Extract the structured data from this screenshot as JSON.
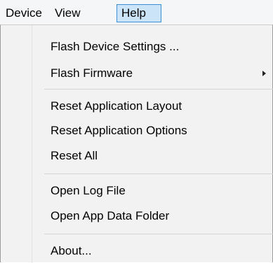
{
  "menubar": {
    "items": [
      {
        "label": "Device",
        "active": false
      },
      {
        "label": "View",
        "active": false
      },
      {
        "label": "Help",
        "active": true
      }
    ]
  },
  "help_menu": {
    "groups": [
      [
        {
          "label": "Flash Device Settings ...",
          "has_submenu": false
        },
        {
          "label": "Flash Firmware",
          "has_submenu": true
        }
      ],
      [
        {
          "label": "Reset Application Layout",
          "has_submenu": false
        },
        {
          "label": "Reset Application Options",
          "has_submenu": false
        },
        {
          "label": "Reset All",
          "has_submenu": false
        }
      ],
      [
        {
          "label": "Open Log File",
          "has_submenu": false
        },
        {
          "label": "Open App Data Folder",
          "has_submenu": false
        }
      ],
      [
        {
          "label": "About...",
          "has_submenu": false
        }
      ]
    ]
  },
  "colors": {
    "menubar_bg": "#f5f6f7",
    "active_item_bg": "#cce4f7",
    "active_item_border": "#3c8fd6",
    "dropdown_bg": "#f2f2f2",
    "separator": "#d4d4d4"
  },
  "icons": {
    "submenu": "chevron-right-icon"
  }
}
